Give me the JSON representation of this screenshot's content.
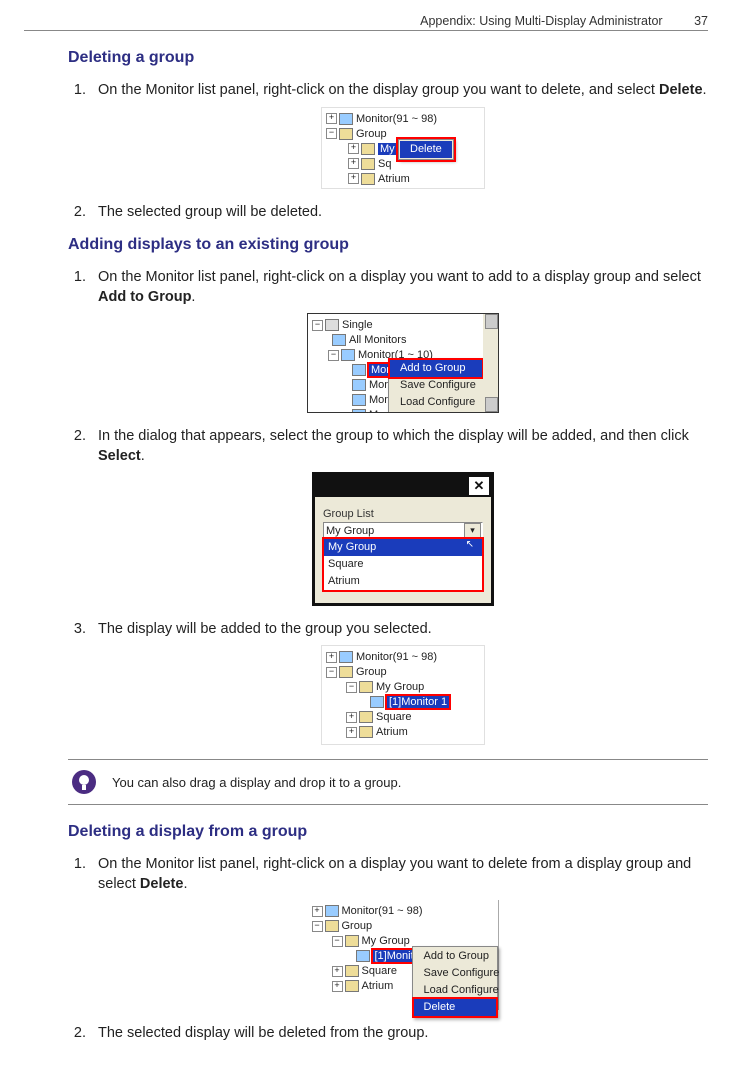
{
  "header": {
    "title": "Appendix: Using Multi-Display Administrator",
    "page": "37"
  },
  "s1": {
    "heading": "Deleting a group",
    "step1a": "On the Monitor list panel, right-click on the display group you want to delete, and select ",
    "step1b": "Delete",
    "step1c": ".",
    "step2": "The selected group will be deleted."
  },
  "fig1": {
    "n0": "Monitor(91 ~ 98)",
    "n1": "Group",
    "n2": "My",
    "n3": "Sq",
    "n4": "Atrium",
    "menu": "Delete"
  },
  "s2": {
    "heading": "Adding displays to an existing group",
    "step1a": "On the Monitor list panel, right-click on a display you want to add to a display group and select ",
    "step1b": "Add to Group",
    "step1c": ".",
    "step2a": "In the dialog that appears, select the group to which the display will be added, and then click ",
    "step2b": "Select",
    "step2c": ".",
    "step3": "The display will be added to the group you selected."
  },
  "fig2": {
    "t0": "Single",
    "t1": "All Monitors",
    "t2": "Monitor(1 ~ 10)",
    "m": "Monito",
    "menu_hi": "Add to Group",
    "menu2": "Save Configure",
    "menu3": "Load Configure"
  },
  "fig3": {
    "label": "Group List",
    "top": "My Group",
    "sel": "My Group",
    "o2": "Square",
    "o3": "Atrium"
  },
  "fig4": {
    "n0": "Monitor(91 ~ 98)",
    "n1": "Group",
    "n2": "My Group",
    "sel": "[1]Monitor 1",
    "n3": "Square",
    "n4": "Atrium"
  },
  "tip": "You can also drag a display and drop it to a group.",
  "s3": {
    "heading": "Deleting a display from a group",
    "step1a": "On the Monitor list panel, right-click on a display you want to delete from a display group and select ",
    "step1b": "Delete",
    "step1c": ".",
    "step2": "The selected display will be deleted from the group."
  },
  "fig5": {
    "n0": "Monitor(91 ~ 98)",
    "n1": "Group",
    "n2": "My Group",
    "sel": "[1]Monitor 1",
    "n3": "Square",
    "n4": "Atrium",
    "m1": "Add to Group",
    "m2": "Save Configure",
    "m3": "Load Configure",
    "m4": "Delete"
  }
}
